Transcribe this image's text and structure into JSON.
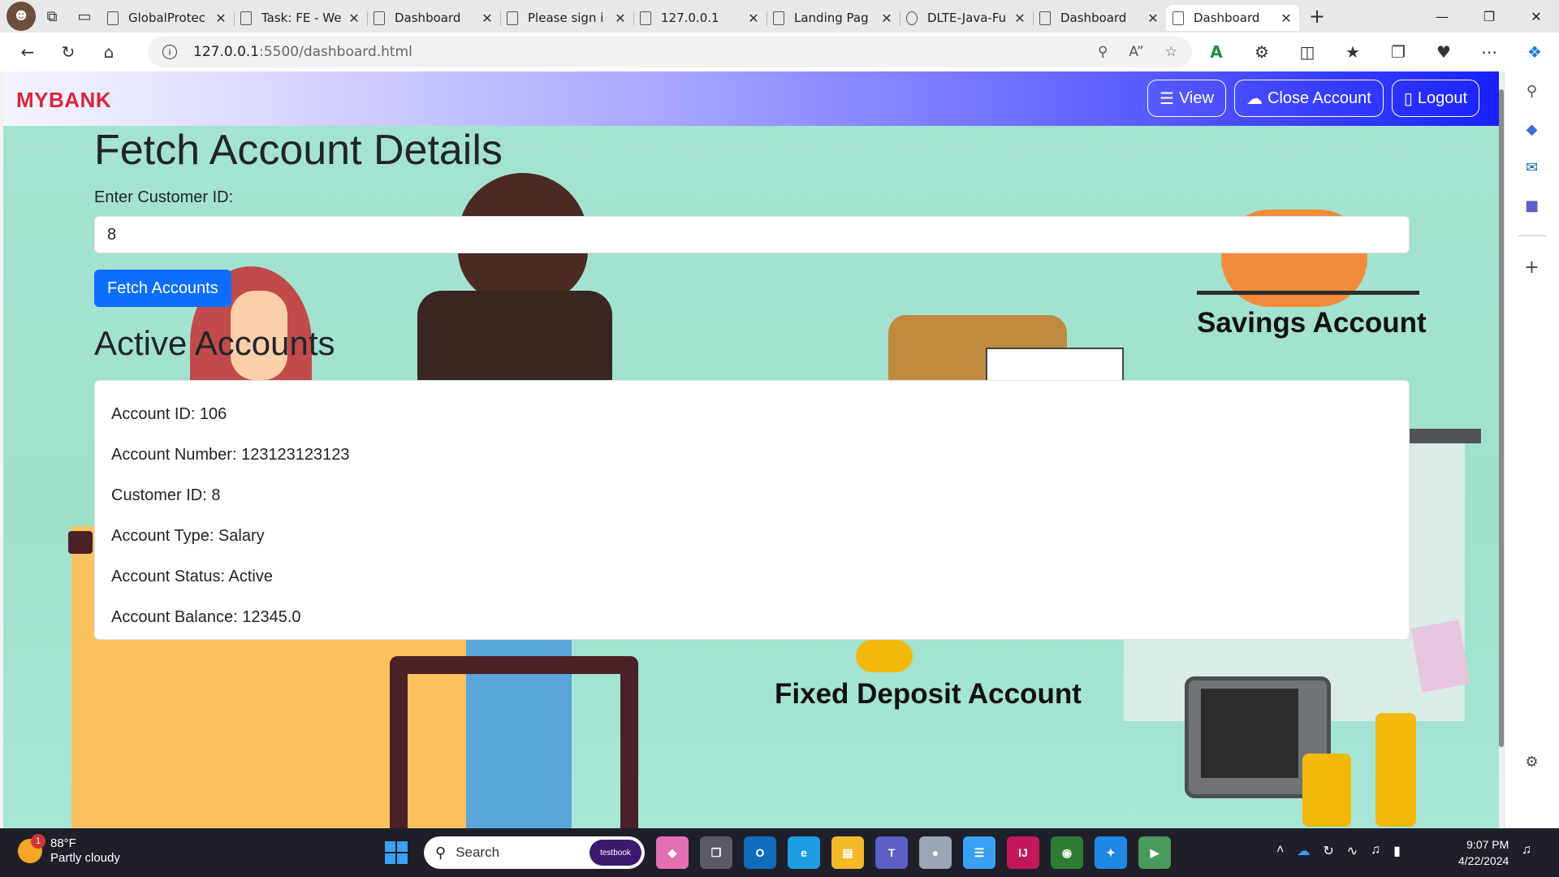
{
  "browser": {
    "tabs": [
      {
        "title": "GlobalProtec",
        "active": false
      },
      {
        "title": "Task: FE - We",
        "active": false
      },
      {
        "title": "Dashboard",
        "active": false
      },
      {
        "title": "Please sign i",
        "active": false
      },
      {
        "title": "127.0.0.1",
        "active": false
      },
      {
        "title": "Landing Pag",
        "active": false
      },
      {
        "title": "DLTE-Java-Fu",
        "active": false
      },
      {
        "title": "Dashboard",
        "active": false
      },
      {
        "title": "Dashboard",
        "active": true
      }
    ],
    "url_host": "127.0.0.1",
    "url_path": ":5500/dashboard.html",
    "colors": {
      "accent": "#0d6efd",
      "brand": "#d7263d"
    }
  },
  "navbar": {
    "brand": "MYBANK",
    "view_label": "View",
    "close_account_label": "Close Account",
    "logout_label": "Logout"
  },
  "main": {
    "title": "Fetch Account Details",
    "customer_id_label": "Enter Customer ID:",
    "customer_id_value": "8",
    "fetch_button_label": "Fetch Accounts",
    "active_accounts_title": "Active Accounts",
    "account": {
      "account_id": "Account ID: 106",
      "account_number": "Account Number: 123123123123",
      "customer_id": "Customer ID: 8",
      "account_type": "Account Type: Salary",
      "account_status": "Account Status: Active",
      "account_balance": "Account Balance: 12345.0"
    }
  },
  "background": {
    "savings_label": "Savings Account",
    "fd_label": "Fixed Deposit Account"
  },
  "taskbar": {
    "weather_badge": "1",
    "temperature": "88°F",
    "condition": "Partly cloudy",
    "search_placeholder": "Search",
    "search_pill": "testbook",
    "time": "9:07 PM",
    "date": "4/22/2024"
  }
}
